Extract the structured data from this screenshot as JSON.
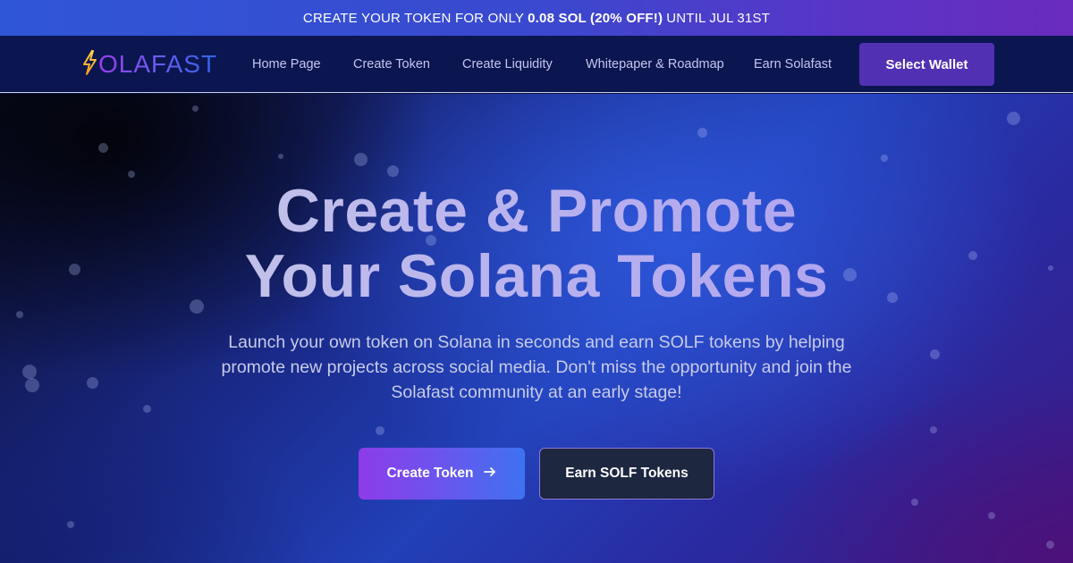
{
  "promo": {
    "prefix": "CREATE YOUR TOKEN FOR ONLY",
    "highlight": "0.08 SOL (20% OFF!)",
    "suffix": "UNTIL JUL 31ST"
  },
  "brand": {
    "name": "OLAFAST",
    "icon": "lightning-bolt-icon"
  },
  "nav": {
    "items": [
      {
        "label": "Home Page"
      },
      {
        "label": "Create Token"
      },
      {
        "label": "Create Liquidity"
      },
      {
        "label": "Whitepaper & Roadmap"
      },
      {
        "label": "Earn Solafast"
      }
    ],
    "wallet_button": "Select Wallet"
  },
  "hero": {
    "title_line1": "Create & Promote",
    "title_line2": "Your Solana Tokens",
    "subtitle": "Launch your own token on Solana in seconds and earn SOLF tokens by helping promote new projects across social media. Don't miss the opportunity and join the Solafast community at an early stage!",
    "primary_button": "Create Token",
    "primary_button_icon": "arrow-right-icon",
    "secondary_button": "Earn SOLF Tokens"
  },
  "colors": {
    "promo_start": "#2f56d6",
    "promo_end": "#6a2bbd",
    "nav_bg": "#0b1650",
    "wallet_button": "#5230b3",
    "primary_gradient_start": "#8d3cea",
    "primary_gradient_end": "#3f72f0",
    "secondary_button_bg": "#1e2740"
  }
}
